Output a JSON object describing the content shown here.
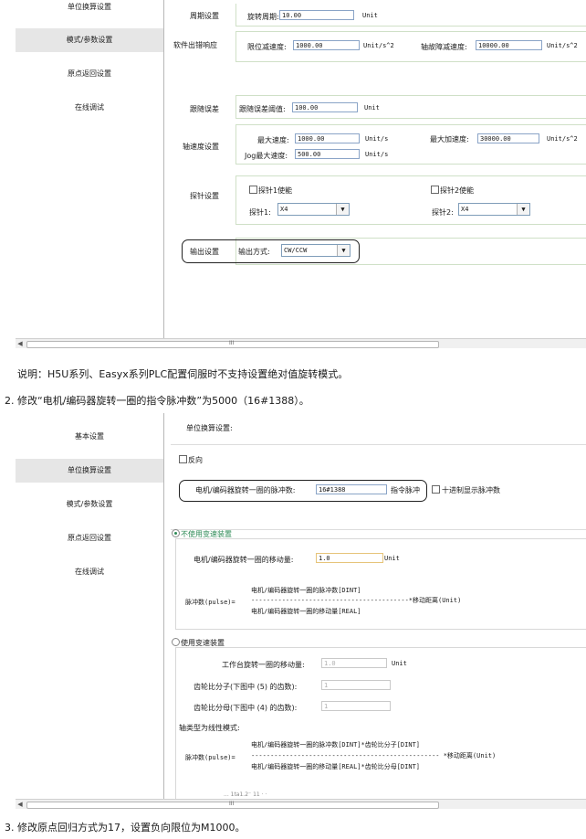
{
  "panel1": {
    "sidebar": [
      {
        "label": "单位换算设置",
        "selected": false
      },
      {
        "label": "模式/参数设置",
        "selected": true
      },
      {
        "label": "原点返回设置",
        "selected": false
      },
      {
        "label": "在线调试",
        "selected": false
      }
    ],
    "period": {
      "group_label": "周期设置",
      "field_label": "旋转周期:",
      "value": "10.00",
      "unit": "Unit"
    },
    "software_error": {
      "group_label": "软件出错响应",
      "limit_label": "限位减速度:",
      "limit_value": "1000.00",
      "limit_unit": "Unit/s^2",
      "fault_label": "轴故障减速度:",
      "fault_value": "10000.00",
      "fault_unit": "Unit/s^2"
    },
    "follow": {
      "group_label": "跟随误差",
      "field_label": "跟随误差阈值:",
      "value": "100.00",
      "unit": "Unit"
    },
    "speed": {
      "group_label": "轴速度设置",
      "max_speed_label": "最大速度:",
      "max_speed_value": "1000.00",
      "max_speed_unit": "Unit/s",
      "max_acc_label": "最大加速度:",
      "max_acc_value": "30000.00",
      "max_acc_unit": "Unit/s^2",
      "jog_label": "Jog最大速度:",
      "jog_value": "500.00",
      "jog_unit": "Unit/s"
    },
    "probe": {
      "group_label": "探针设置",
      "probe1_enable": "探针1使能",
      "probe2_enable": "探针2使能",
      "probe1_label": "探针1:",
      "probe1_value": "X4",
      "probe2_label": "探针2:",
      "probe2_value": "X4"
    },
    "output": {
      "group_label": "输出设置",
      "field_label": "输出方式:",
      "value": "CW/CCW"
    },
    "scroll_grip": "III"
  },
  "note": "说明：H5U系列、Easyx系列PLC配置伺服时不支持设置绝对值旋转模式。",
  "step2": "2. 修改“电机/编码器旋转一圈的指令脉冲数”为5000（16#1388）。",
  "panel2": {
    "sidebar": [
      {
        "label": "基本设置",
        "selected": false
      },
      {
        "label": "单位换算设置",
        "selected": true
      },
      {
        "label": "模式/参数设置",
        "selected": false
      },
      {
        "label": "原点返回设置",
        "selected": false
      },
      {
        "label": "在线调试",
        "selected": false
      }
    ],
    "header": "单位换算设置:",
    "reverse": "反向",
    "pulses_label": "电机/编码器旋转一圈的脉冲数:",
    "pulses_value": "16#1388",
    "pulses_unit": "指令脉冲",
    "hex_display": "十进制显示脉冲数",
    "no_gear_radio": "不使用变速装置",
    "move_label": "电机/编码器旋转一圈的移动量:",
    "move_value": "1.0",
    "move_unit": "Unit",
    "formula1": {
      "lhs": "脉冲数(pulse)=",
      "num": "电机/编码器旋转一圈的脉冲数[DINT]",
      "dashes": "-----------------------------------------*移动距离(Unit)",
      "den": "电机/编码器旋转一圈的移动量[REAL]"
    },
    "gear_radio": "使用变速装置",
    "table_move_label": "工作台旋转一圈的移动量:",
    "table_move_value": "1.0",
    "table_move_unit": "Unit",
    "gear_num_label": "齿轮比分子(下图中 (5) 的齿数):",
    "gear_num_value": "1",
    "gear_den_label": "齿轮比分母(下图中 (4) 的齿数):",
    "gear_den_value": "1",
    "linear_label": "轴类型为线性模式:",
    "formula2": {
      "lhs": "脉冲数(pulse)=",
      "num": "电机/编码器旋转一圈的脉冲数[DINT]*齿轮比分子[DINT]",
      "dashes": "-------------------------------------------------  *移动距离(Unit)",
      "den": "电机/编码器旋转一圈的移动量[REAL]*齿轮比分母[DINT]"
    },
    "cut_text": "... 1ta1.2⁻ 11 · ·",
    "scroll_grip": "III"
  },
  "step3": "3. 修改原点回归方式为17，设置负向限位为M1000。",
  "colors": {
    "selected_bg": "#e6e6e6",
    "group_border": "#cfe0c7",
    "radio_green": "#2e8b57"
  }
}
